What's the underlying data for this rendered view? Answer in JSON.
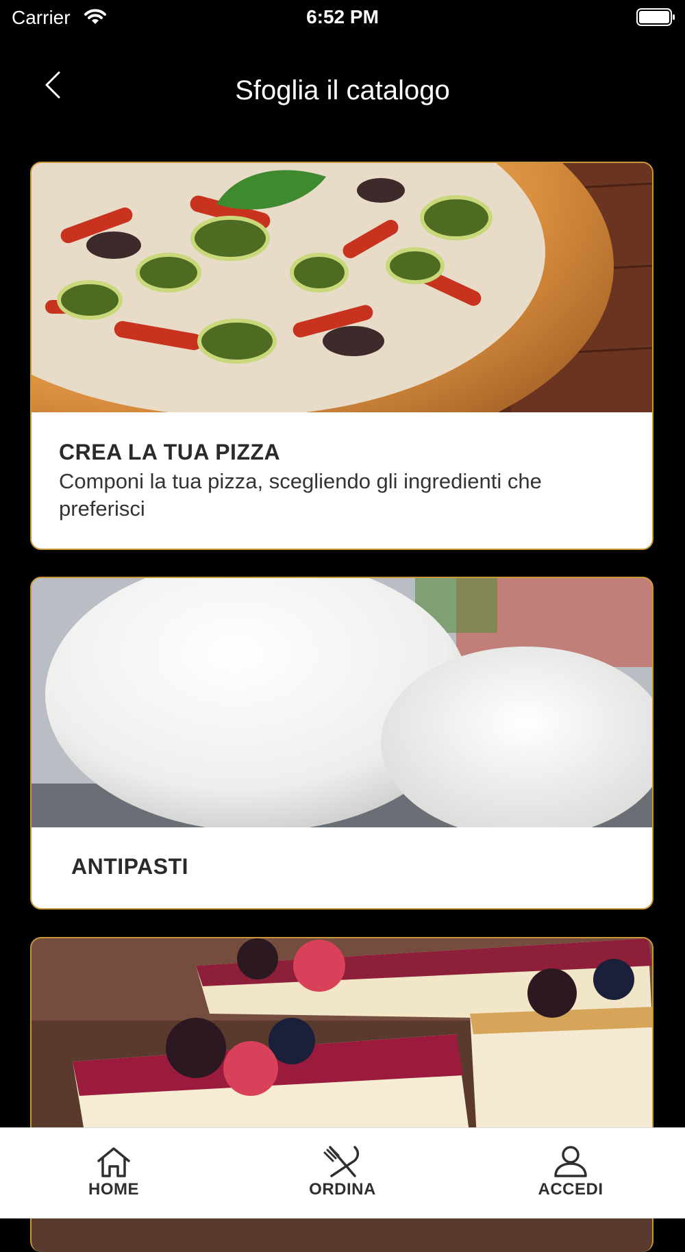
{
  "status_bar": {
    "carrier": "Carrier",
    "time": "6:52 PM"
  },
  "nav": {
    "title": "Sfoglia il catalogo",
    "back_icon": "chevron-left-icon"
  },
  "cards": [
    {
      "title": "CREA LA TUA PIZZA",
      "description": "Componi la tua pizza, scegliendo gli ingredienti che preferisci",
      "image": "pizza-vegetables-photo"
    },
    {
      "title": "ANTIPASTI",
      "image": "burrata-photo"
    },
    {
      "image": "berry-cheesecake-photo"
    }
  ],
  "tabs": [
    {
      "label": "HOME",
      "icon": "home-icon"
    },
    {
      "label": "ORDINA",
      "icon": "fork-knife-icon"
    },
    {
      "label": "ACCEDI",
      "icon": "user-icon"
    }
  ],
  "colors": {
    "background": "#000000",
    "card_border": "#c9963a",
    "tab_text": "#2f2f2f"
  }
}
